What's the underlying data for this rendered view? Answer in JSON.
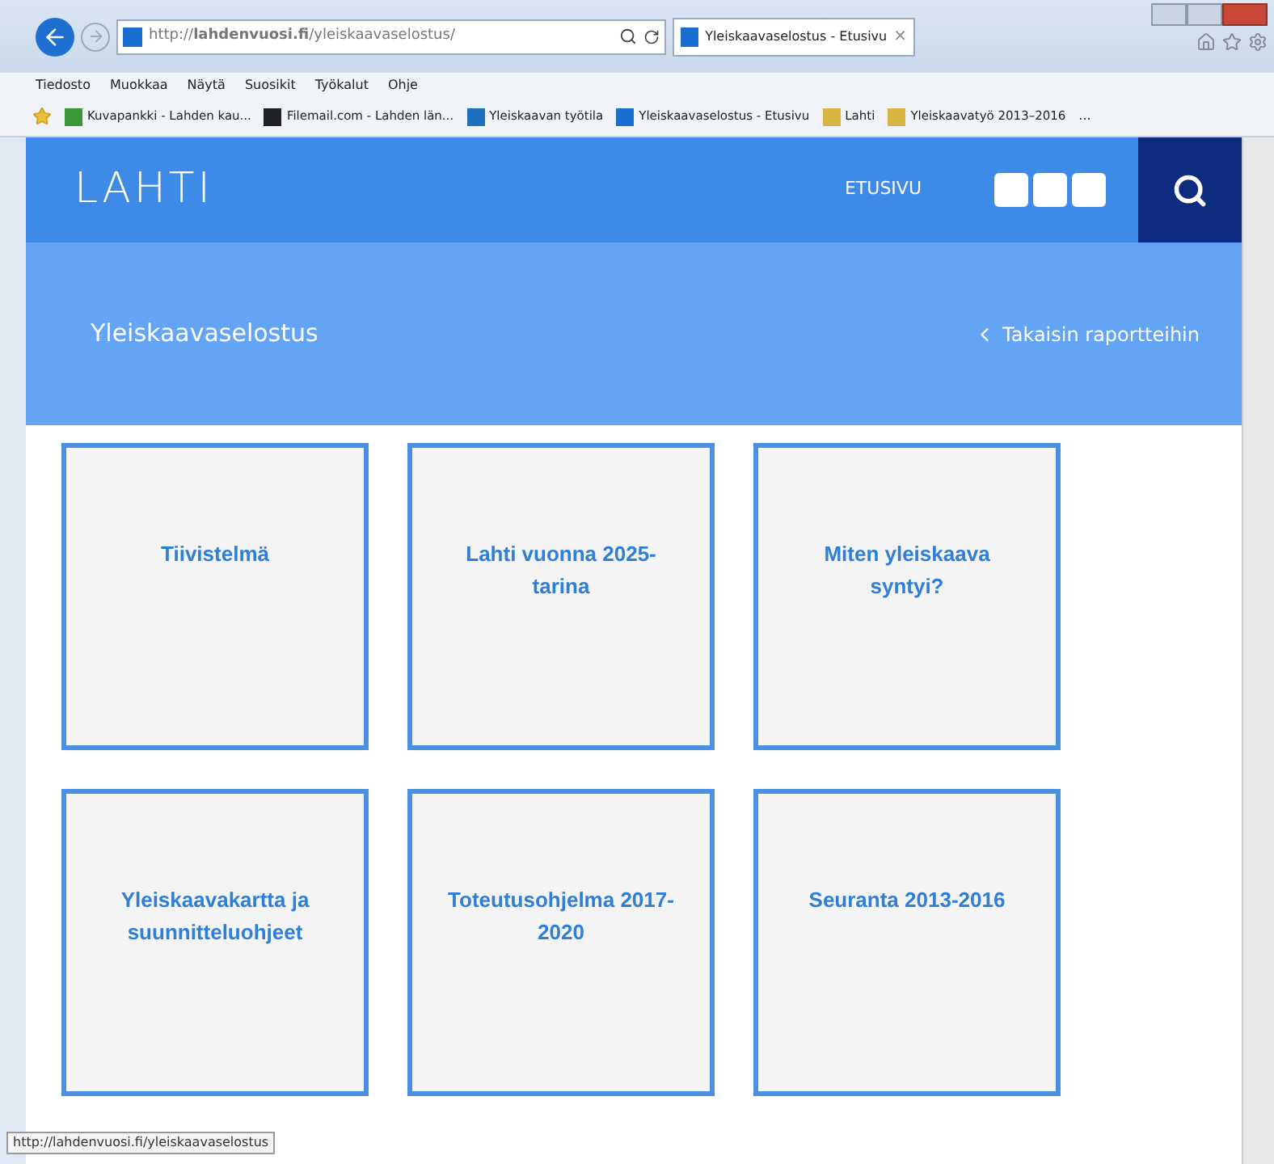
{
  "browser": {
    "url": "http://**lahdenvuosi.fi**/yleiskaavaselostus/",
    "tab": {
      "title": "Yleiskaavaselostus - Etusivu",
      "close": "×",
      "selected": true
    },
    "menu": [
      "Tiedosto",
      "Muokkaa",
      "Näytä",
      "Suosikit",
      "Työkalut",
      "Ohje"
    ],
    "favorites": [
      {
        "label": "Kuvapankki - Lahden kau...",
        "color": "#3a9a3a"
      },
      {
        "label": "Filemail.com - Lahden län...",
        "color": "#222222"
      },
      {
        "label": "Yleiskaavan työtila",
        "color": "#1e6fc0"
      },
      {
        "label": "Yleiskaavaselostus - Etusivu",
        "color": "#1b6fd0"
      },
      {
        "label": "Lahti",
        "color": "#d8b440"
      },
      {
        "label": "Yleiskaavatyö 2013–2016",
        "color": "#d8b440"
      }
    ],
    "favorites_more": "...",
    "status_url": "http://lahdenvuosi.fi/yleiskaavaselostus"
  },
  "site": {
    "logo": "LAHTI",
    "nav": "ETUSIVU",
    "page_title": "Yleiskaavaselostus",
    "back_link": "Takaisin raportteihin",
    "tiles": [
      "Tiivistelmä",
      "Lahti vuonna 2025-tarina",
      "Miten yleiskaava syntyi?",
      "Yleiskaavakartta ja suunnitteluohjeet",
      "Toteutusohjelma 2017-2020",
      "Seuranta 2013-2016"
    ]
  }
}
